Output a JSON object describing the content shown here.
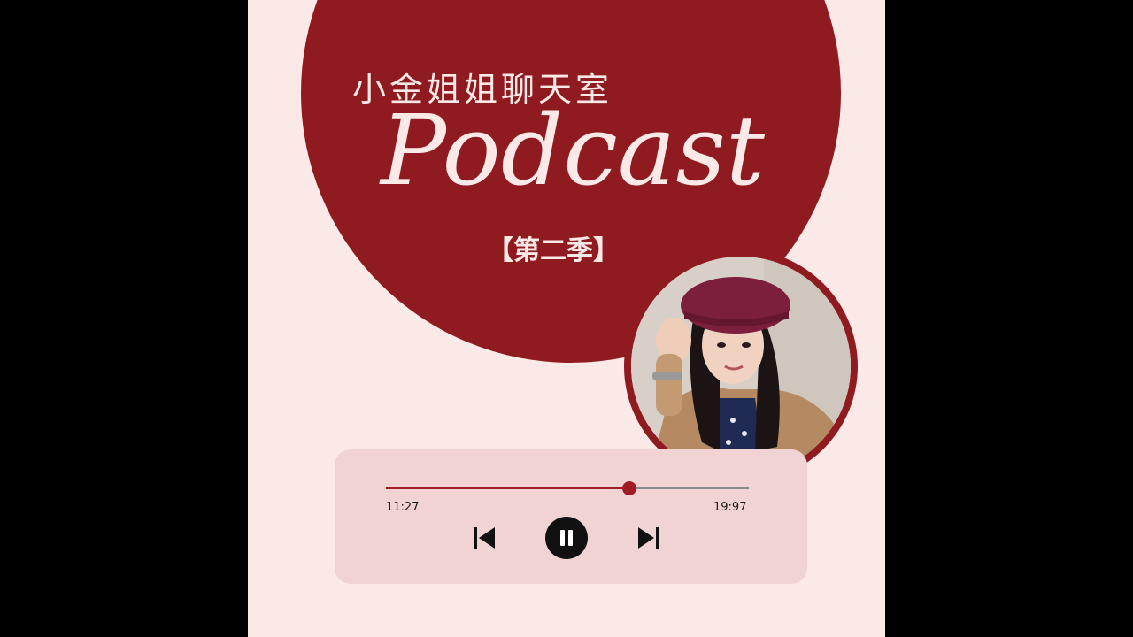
{
  "title": {
    "chinese": "小金姐姐聊天室",
    "script": "Podcast",
    "season": "【第二季】"
  },
  "player": {
    "elapsed": "11:27",
    "total": "19:97",
    "progress_fraction": 0.67
  },
  "icons": {
    "previous": "skip-previous-icon",
    "pause": "pause-icon",
    "next": "skip-next-icon"
  },
  "colors": {
    "background": "#fbe9e8",
    "accent": "#8f1a1f",
    "player_bg": "#f1d3d3"
  }
}
